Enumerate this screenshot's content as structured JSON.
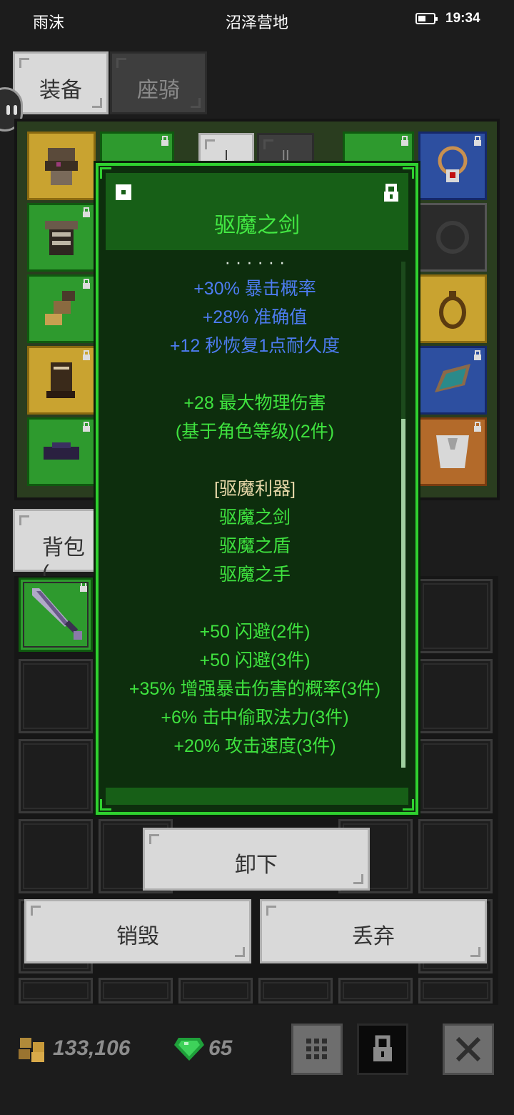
{
  "status_bar": {
    "left": "雨沫",
    "center": "沼泽营地",
    "time": "19:34"
  },
  "tabs": {
    "equipment": "装备",
    "mount": "座骑",
    "backpack": "背包",
    "backpack_suffix": "("
  },
  "equip_subtabs": [
    "I",
    "II"
  ],
  "tooltip": {
    "title": "驱魔之剑",
    "cut_line": "· · · · · ·",
    "lines": [
      {
        "text": "+30% 暴击概率",
        "color": "blue"
      },
      {
        "text": "+28% 准确值",
        "color": "blue"
      },
      {
        "text": "+12 秒恢复1点耐久度",
        "color": "blue"
      },
      {
        "text": "",
        "color": "blank"
      },
      {
        "text": "+28 最大物理伤害",
        "color": "green"
      },
      {
        "text": "(基于角色等级)(2件)",
        "color": "green"
      },
      {
        "text": "",
        "color": "blank"
      },
      {
        "text": "[驱魔利器]",
        "color": "tan"
      },
      {
        "text": "驱魔之剑",
        "color": "green"
      },
      {
        "text": "驱魔之盾",
        "color": "green"
      },
      {
        "text": "驱魔之手",
        "color": "green"
      },
      {
        "text": "",
        "color": "blank"
      },
      {
        "text": "+50 闪避(2件)",
        "color": "green"
      },
      {
        "text": "+50 闪避(3件)",
        "color": "green"
      },
      {
        "text": "+35% 增强暴击伤害的概率(3件)",
        "color": "green"
      },
      {
        "text": "+6% 击中偷取法力(3件)",
        "color": "green"
      },
      {
        "text": "+20% 攻击速度(3件)",
        "color": "green"
      }
    ],
    "scroll_fraction": 0.31
  },
  "actions": {
    "unequip": "卸下",
    "destroy": "销毁",
    "discard": "丢弃"
  },
  "currency": {
    "gold": "133,106",
    "gems": "65"
  },
  "colors": {
    "tooltip_border": "#2fd12f",
    "title_text": "#43e843",
    "stat_blue": "#4d7cf0",
    "stat_green": "#3fe23f",
    "set_tan": "#e6d7a8"
  },
  "icons": [
    "battery-icon",
    "helmet-icon",
    "armor-icon",
    "gloves-icon",
    "boots-icon",
    "belt-icon",
    "amulet-icon",
    "ring-icon",
    "shield-icon",
    "cape-icon",
    "sword-icon",
    "lock-icon",
    "gold-icon",
    "gem-icon",
    "grid-icon",
    "close-icon"
  ]
}
